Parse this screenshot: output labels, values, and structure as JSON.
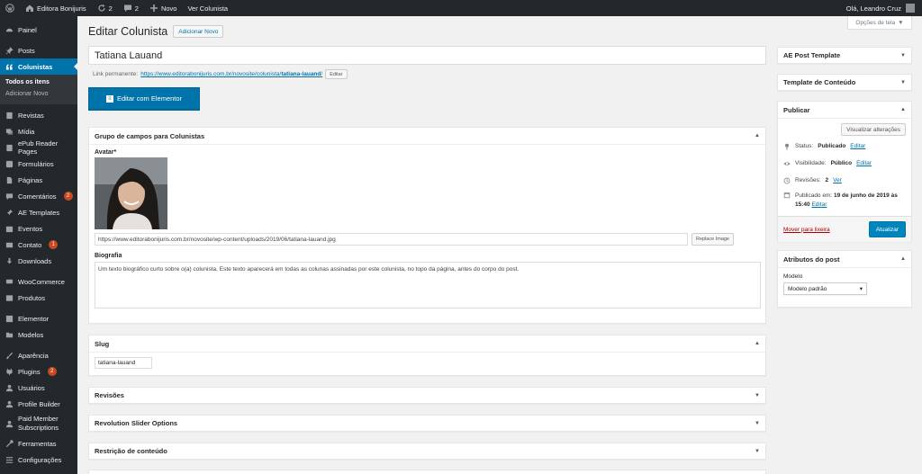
{
  "admin_bar": {
    "site_name": "Editora Bonijuris",
    "updates_count": "2",
    "comments_count": "2",
    "new_label": "Novo",
    "view_label": "Ver Colunista",
    "greeting": "Olá, Leandro Cruz"
  },
  "sidebar": {
    "items": [
      {
        "label": "Painel",
        "icon": "dashboard-icon"
      },
      {
        "label": "Posts",
        "icon": "pin-icon"
      },
      {
        "label": "Colunistas",
        "icon": "quote-icon"
      },
      {
        "label": "Revistas",
        "icon": "book-icon"
      },
      {
        "label": "Mídia",
        "icon": "media-icon"
      },
      {
        "label": "ePub Reader Pages",
        "icon": "book-icon"
      },
      {
        "label": "Formulários",
        "icon": "forms-icon"
      },
      {
        "label": "Páginas",
        "icon": "page-icon"
      },
      {
        "label": "Comentários",
        "icon": "comment-icon",
        "badge": "2"
      },
      {
        "label": "AE Templates",
        "icon": "pin-icon"
      },
      {
        "label": "Eventos",
        "icon": "calendar-icon"
      },
      {
        "label": "Contato",
        "icon": "mail-icon",
        "badge": "1"
      },
      {
        "label": "Downloads",
        "icon": "download-icon"
      },
      {
        "label": "WooCommerce",
        "icon": "woo-icon"
      },
      {
        "label": "Produtos",
        "icon": "archive-icon"
      },
      {
        "label": "Elementor",
        "icon": "elementor-icon"
      },
      {
        "label": "Modelos",
        "icon": "folder-icon"
      },
      {
        "label": "Aparência",
        "icon": "brush-icon"
      },
      {
        "label": "Plugins",
        "icon": "plugin-icon",
        "badge": "2"
      },
      {
        "label": "Usuários",
        "icon": "users-icon"
      },
      {
        "label": "Profile Builder",
        "icon": "user-icon"
      },
      {
        "label": "Paid Member Subscriptions",
        "icon": "member-icon"
      },
      {
        "label": "Ferramentas",
        "icon": "wrench-icon"
      },
      {
        "label": "Configurações",
        "icon": "settings-icon"
      }
    ],
    "submenu": [
      "Todos os itens",
      "Adicionar Novo"
    ]
  },
  "screen_options": "Opções de tela",
  "page": {
    "title": "Editar Colunista",
    "add_new": "Adicionar Novo",
    "post_title": "Tatiana Lauand",
    "permalink_label": "Link permanente:",
    "permalink_base": "https://www.editorabonijuris.com.br/novosite/colunista/",
    "permalink_slug": "tatiana-lauand",
    "permalink_end": "/",
    "permalink_edit": "Editar",
    "elementor_button": "Editar com Elementor"
  },
  "acf_box": {
    "title": "Grupo de campos para Colunistas",
    "avatar_label": "Avatar*",
    "avatar_url": "https://www.editorabonijuris.com.br/novosite/wp-content/uploads/2019/06/tatiana-lauand.jpg",
    "replace_label": "Replace Image",
    "bio_label": "Biografia",
    "bio_text": "Um texto biográfico curto sobre o(a) colunista. Este texto aparecerá em todas as colunas assinadas por este colunista, no topo da página, antes do corpo do post."
  },
  "slug_box": {
    "title": "Slug",
    "value": "tatiana-lauand"
  },
  "collapsed_boxes": [
    "Revisões",
    "Revolution Slider Options",
    "Restrição de conteúdo"
  ],
  "side": {
    "ae_post_template": "AE Post Template",
    "content_template": "Template de Conteúdo",
    "publish": {
      "title": "Publicar",
      "preview": "Visualizar alterações",
      "status_label": "Status:",
      "status_value": "Publicado",
      "visibility_label": "Visibilidade:",
      "visibility_value": "Público",
      "revisions_label": "Revisões:",
      "revisions_value": "2",
      "revisions_link": "Ver",
      "published_label": "Publicado em:",
      "published_value": "19 de junho de 2019 às",
      "published_time": "15:40",
      "edit": "Editar",
      "trash": "Mover para lixeira",
      "update": "Atualizar"
    },
    "attributes": {
      "title": "Atributos do post",
      "model_label": "Modelo",
      "model_value": "Modelo padrão"
    }
  }
}
